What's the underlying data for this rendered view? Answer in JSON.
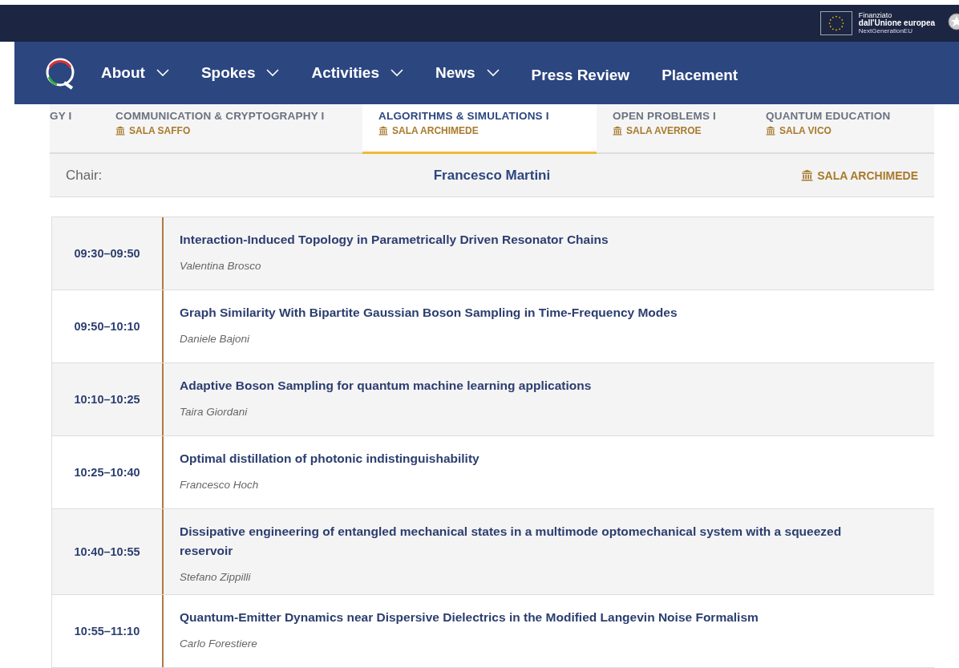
{
  "funding": {
    "lines": [
      "Finanziato",
      "dall'Unione europea",
      "NextGenerationEU"
    ]
  },
  "nav": [
    {
      "label": "About",
      "dropdown": true
    },
    {
      "label": "Spokes",
      "dropdown": true
    },
    {
      "label": "Activities",
      "dropdown": true
    },
    {
      "label": "News",
      "dropdown": true
    },
    {
      "label": "Press Review",
      "dropdown": false
    },
    {
      "label": "Placement",
      "dropdown": false
    }
  ],
  "tabs": [
    {
      "label": "GY I",
      "selected": false
    },
    {
      "label": "COMMUNICATION & CRYPTOGRAPHY I",
      "room": "SALA SAFFO",
      "selected": false
    },
    {
      "label": "ALGORITHMS & SIMULATIONS I",
      "room": "SALA ARCHIMEDE",
      "selected": true
    },
    {
      "label": "OPEN PROBLEMS I",
      "room": "SALA AVERROE",
      "selected": false
    },
    {
      "label": "QUANTUM EDUCATION",
      "room": "SALA VICO",
      "selected": false
    }
  ],
  "chair": {
    "label": "Chair:",
    "name": "Francesco Martini",
    "room": "SALA ARCHIMEDE"
  },
  "talks": [
    {
      "time": "09:30–09:50",
      "title": "Interaction-Induced Topology in Parametrically Driven Resonator Chains",
      "author": "Valentina Brosco"
    },
    {
      "time": "09:50–10:10",
      "title": "Graph Similarity With Bipartite Gaussian Boson Sampling in Time-Frequency Modes",
      "author": "Daniele Bajoni"
    },
    {
      "time": "10:10–10:25",
      "title": "Adaptive Boson Sampling for quantum machine learning applications",
      "author": "Taira Giordani"
    },
    {
      "time": "10:25–10:40",
      "title": "Optimal distillation of photonic indistinguishability",
      "author": "Francesco Hoch"
    },
    {
      "time": "10:40–10:55",
      "title": "Dissipative engineering of entangled mechanical states in a multimode optomechanical system with a squeezed reservoir",
      "author": "Stefano Zippilli"
    },
    {
      "time": "10:55–11:10",
      "title": "Quantum-Emitter Dynamics near Dispersive Dielectrics in the Modified Langevin Noise Formalism",
      "author": "Carlo Forestiere"
    }
  ]
}
